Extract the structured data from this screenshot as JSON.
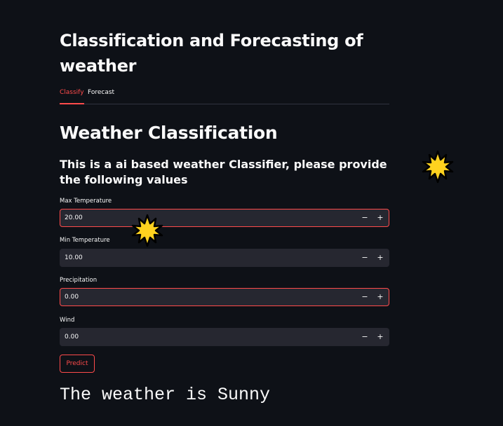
{
  "app": {
    "title": "Classification and Forecasting of weather"
  },
  "tabs": [
    {
      "label": "Classify",
      "active": true
    },
    {
      "label": "Forecast",
      "active": false
    }
  ],
  "classify": {
    "heading": "Weather Classification",
    "subheading": "This is a ai based weather Classifier, please provide the following values",
    "fields": [
      {
        "label": "Max Temperature",
        "value": "20.00",
        "minus": "−",
        "plus": "+"
      },
      {
        "label": "Min Temperature",
        "value": "10.00",
        "minus": "−",
        "plus": "+"
      },
      {
        "label": "Precipitation",
        "value": "0.00",
        "minus": "−",
        "plus": "+"
      },
      {
        "label": "Wind",
        "value": "0.00",
        "minus": "−",
        "plus": "+"
      }
    ],
    "predict_label": "Predict",
    "result": "The weather is Sunny"
  },
  "colors": {
    "background": "#0e1117",
    "input_bg": "#262730",
    "accent": "#ff4b4b",
    "text": "#fafafa",
    "sun_fill": "#ffd21f",
    "sun_stroke": "#000000"
  },
  "icons": [
    "sun-icon"
  ]
}
